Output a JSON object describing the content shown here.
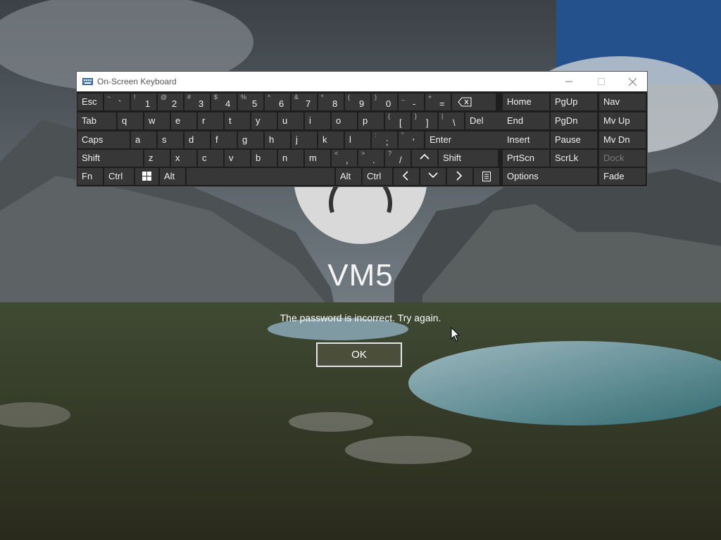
{
  "lock_screen": {
    "username": "VM5",
    "message": "The password is incorrect. Try again.",
    "ok_label": "OK"
  },
  "osk": {
    "title": "On-Screen Keyboard",
    "rows": [
      [
        {
          "id": "esc",
          "label": "Esc"
        },
        {
          "id": "tilde",
          "shift": "~",
          "main": "`"
        },
        {
          "id": "1",
          "shift": "!",
          "main": "1"
        },
        {
          "id": "2",
          "shift": "@",
          "main": "2"
        },
        {
          "id": "3",
          "shift": "#",
          "main": "3"
        },
        {
          "id": "4",
          "shift": "$",
          "main": "4"
        },
        {
          "id": "5",
          "shift": "%",
          "main": "5"
        },
        {
          "id": "6",
          "shift": "^",
          "main": "6"
        },
        {
          "id": "7",
          "shift": "&",
          "main": "7"
        },
        {
          "id": "8",
          "shift": "*",
          "main": "8"
        },
        {
          "id": "9",
          "shift": "(",
          "main": "9"
        },
        {
          "id": "0",
          "shift": ")",
          "main": "0"
        },
        {
          "id": "minus",
          "shift": "_",
          "main": "-"
        },
        {
          "id": "equals",
          "shift": "+",
          "main": "="
        },
        {
          "id": "backspace",
          "label": "⌫"
        }
      ],
      [
        {
          "id": "tab",
          "label": "Tab"
        },
        {
          "id": "q",
          "label": "q"
        },
        {
          "id": "w",
          "label": "w"
        },
        {
          "id": "e",
          "label": "e"
        },
        {
          "id": "r",
          "label": "r"
        },
        {
          "id": "t",
          "label": "t"
        },
        {
          "id": "y",
          "label": "y"
        },
        {
          "id": "u",
          "label": "u"
        },
        {
          "id": "i",
          "label": "i"
        },
        {
          "id": "o",
          "label": "o"
        },
        {
          "id": "p",
          "label": "p"
        },
        {
          "id": "lbracket",
          "shift": "{",
          "main": "["
        },
        {
          "id": "rbracket",
          "shift": "}",
          "main": "]"
        },
        {
          "id": "backslash",
          "shift": "|",
          "main": "\\"
        },
        {
          "id": "del",
          "label": "Del"
        }
      ],
      [
        {
          "id": "caps",
          "label": "Caps"
        },
        {
          "id": "a",
          "label": "a"
        },
        {
          "id": "s",
          "label": "s"
        },
        {
          "id": "d",
          "label": "d"
        },
        {
          "id": "f",
          "label": "f"
        },
        {
          "id": "g",
          "label": "g"
        },
        {
          "id": "h",
          "label": "h"
        },
        {
          "id": "j",
          "label": "j"
        },
        {
          "id": "k",
          "label": "k"
        },
        {
          "id": "l",
          "label": "l"
        },
        {
          "id": "semicolon",
          "shift": ":",
          "main": ";"
        },
        {
          "id": "quote",
          "shift": "\"",
          "main": "'"
        },
        {
          "id": "enter",
          "label": "Enter"
        }
      ],
      [
        {
          "id": "lshift",
          "label": "Shift"
        },
        {
          "id": "z",
          "label": "z"
        },
        {
          "id": "x",
          "label": "x"
        },
        {
          "id": "c",
          "label": "c"
        },
        {
          "id": "v",
          "label": "v"
        },
        {
          "id": "b",
          "label": "b"
        },
        {
          "id": "n",
          "label": "n"
        },
        {
          "id": "m",
          "label": "m"
        },
        {
          "id": "comma",
          "shift": "<",
          "main": ","
        },
        {
          "id": "period",
          "shift": ">",
          "main": "."
        },
        {
          "id": "slash",
          "shift": "?",
          "main": "/"
        },
        {
          "id": "up",
          "label": "^"
        },
        {
          "id": "rshift",
          "label": "Shift"
        }
      ],
      [
        {
          "id": "fn",
          "label": "Fn"
        },
        {
          "id": "lctrl",
          "label": "Ctrl"
        },
        {
          "id": "win",
          "label": "win"
        },
        {
          "id": "lalt",
          "label": "Alt"
        },
        {
          "id": "space",
          "label": ""
        },
        {
          "id": "ralt",
          "label": "Alt"
        },
        {
          "id": "rctrl",
          "label": "Ctrl"
        },
        {
          "id": "left",
          "label": "<"
        },
        {
          "id": "down",
          "label": "v"
        },
        {
          "id": "right",
          "label": ">"
        },
        {
          "id": "menu",
          "label": "menu"
        }
      ]
    ],
    "nav_keys": [
      [
        "Home",
        "PgUp",
        "Nav"
      ],
      [
        "End",
        "PgDn",
        "Mv Up"
      ],
      [
        "Insert",
        "Pause",
        "Mv Dn"
      ],
      [
        "PrtScn",
        "ScrLk",
        "Dock"
      ],
      [
        "Options",
        "Fade"
      ]
    ],
    "colors": {
      "key_bg": "#373737",
      "panel_bg": "#1e1e1e",
      "text": "#f0f0f0"
    }
  }
}
